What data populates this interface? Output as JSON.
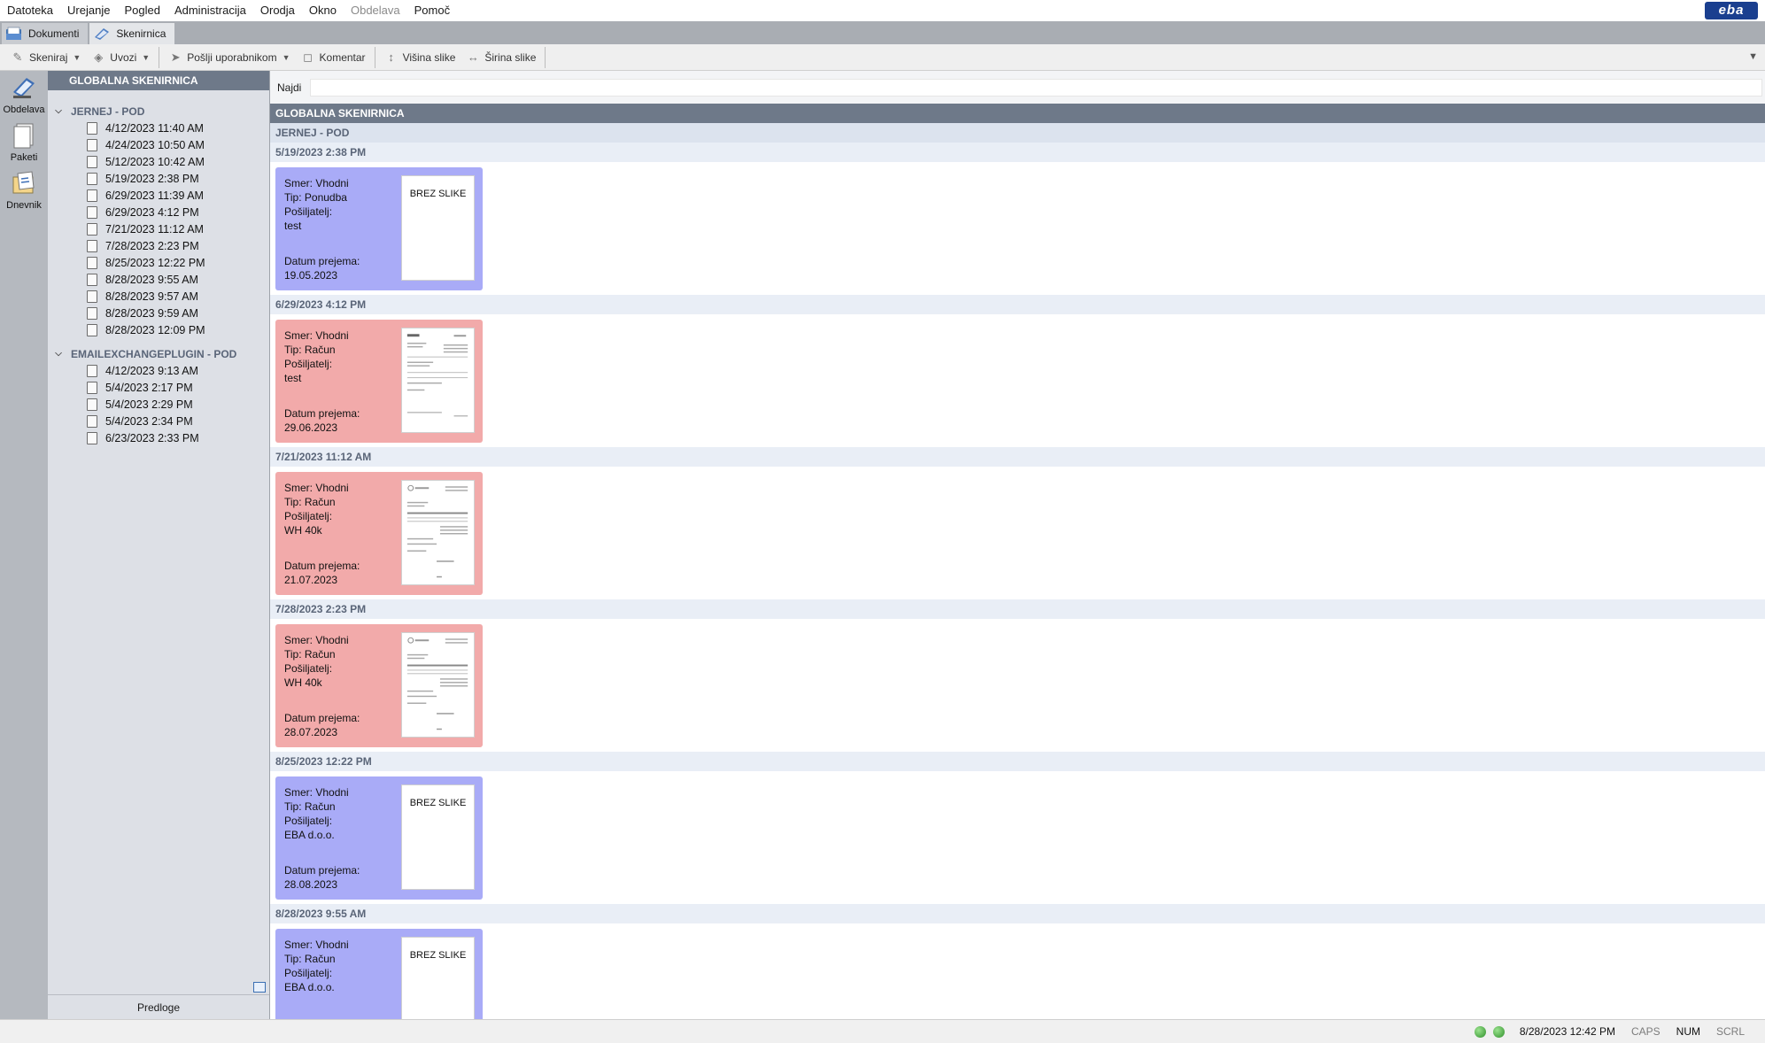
{
  "menu": {
    "items": [
      "Datoteka",
      "Urejanje",
      "Pogled",
      "Administracija",
      "Orodja",
      "Okno",
      "Obdelava",
      "Pomoč"
    ],
    "logo": "eba"
  },
  "tabs": {
    "documents": "Dokumenti",
    "scanner": "Skenirnica"
  },
  "toolbar": {
    "scan": "Skeniraj",
    "import": "Uvozi",
    "send": "Pošlji uporabnikom",
    "comment": "Komentar",
    "image_height": "Višina slike",
    "image_width": "Širina slike"
  },
  "iconbar": {
    "processing": "Obdelava",
    "packages": "Paketi",
    "journal": "Dnevnik"
  },
  "tree": {
    "header": "GLOBALNA SKENIRNICA",
    "groups": [
      {
        "name": "JERNEJ - POD",
        "items": [
          "4/12/2023 11:40 AM",
          "4/24/2023 10:50 AM",
          "5/12/2023 10:42 AM",
          "5/19/2023 2:38 PM",
          "6/29/2023 11:39 AM",
          "6/29/2023 4:12 PM",
          "7/21/2023 11:12 AM",
          "7/28/2023 2:23 PM",
          "8/25/2023 12:22 PM",
          "8/28/2023 9:55 AM",
          "8/28/2023 9:57 AM",
          "8/28/2023 9:59 AM",
          "8/28/2023 12:09 PM"
        ]
      },
      {
        "name": "EMAILEXCHANGEPLUGIN - POD",
        "items": [
          "4/12/2023 9:13 AM",
          "5/4/2023 2:17 PM",
          "5/4/2023 2:29 PM",
          "5/4/2023 2:34 PM",
          "6/23/2023 2:33 PM"
        ]
      }
    ],
    "footer": "Predloge"
  },
  "main": {
    "search_label": "Najdi",
    "search_value": "",
    "header": "GLOBALNA SKENIRNICA",
    "group": "JERNEJ - POD",
    "entries": [
      {
        "date": "5/19/2023 2:38 PM",
        "color": "#a9abf7",
        "direction": "Smer: Vhodni",
        "type": "Tip: Ponudba",
        "sender_label": "Pošiljatelj:",
        "sender": "test",
        "received_label": "Datum prejema:",
        "received": "19.05.2023",
        "thumb": "BREZ SLIKE"
      },
      {
        "date": "6/29/2023 4:12 PM",
        "color": "#f2aaaa",
        "direction": "Smer: Vhodni",
        "type": "Tip: Račun",
        "sender_label": "Pošiljatelj:",
        "sender": "test",
        "received_label": "Datum prejema:",
        "received": "29.06.2023",
        "thumb": ""
      },
      {
        "date": "7/21/2023 11:12 AM",
        "color": "#f2aaaa",
        "direction": "Smer: Vhodni",
        "type": "Tip: Račun",
        "sender_label": "Pošiljatelj:",
        "sender": "WH 40k",
        "received_label": "Datum prejema:",
        "received": "21.07.2023",
        "thumb": ""
      },
      {
        "date": "7/28/2023 2:23 PM",
        "color": "#f2aaaa",
        "direction": "Smer: Vhodni",
        "type": "Tip: Račun",
        "sender_label": "Pošiljatelj:",
        "sender": "WH 40k",
        "received_label": "Datum prejema:",
        "received": "28.07.2023",
        "thumb": ""
      },
      {
        "date": "8/25/2023 12:22 PM",
        "color": "#a9abf7",
        "direction": "Smer: Vhodni",
        "type": "Tip: Račun",
        "sender_label": "Pošiljatelj:",
        "sender": "EBA d.o.o.",
        "received_label": "Datum prejema:",
        "received": "28.08.2023",
        "thumb": "BREZ SLIKE"
      },
      {
        "date": "8/28/2023 9:55 AM",
        "color": "#a9abf7",
        "direction": "Smer: Vhodni",
        "type": "Tip: Račun",
        "sender_label": "Pošiljatelj:",
        "sender": "EBA d.o.o.",
        "received_label": "",
        "received": "",
        "thumb": "BREZ SLIKE"
      }
    ]
  },
  "status": {
    "datetime": "8/28/2023 12:42 PM",
    "caps": "CAPS",
    "num": "NUM",
    "scrl": "SCRL"
  }
}
